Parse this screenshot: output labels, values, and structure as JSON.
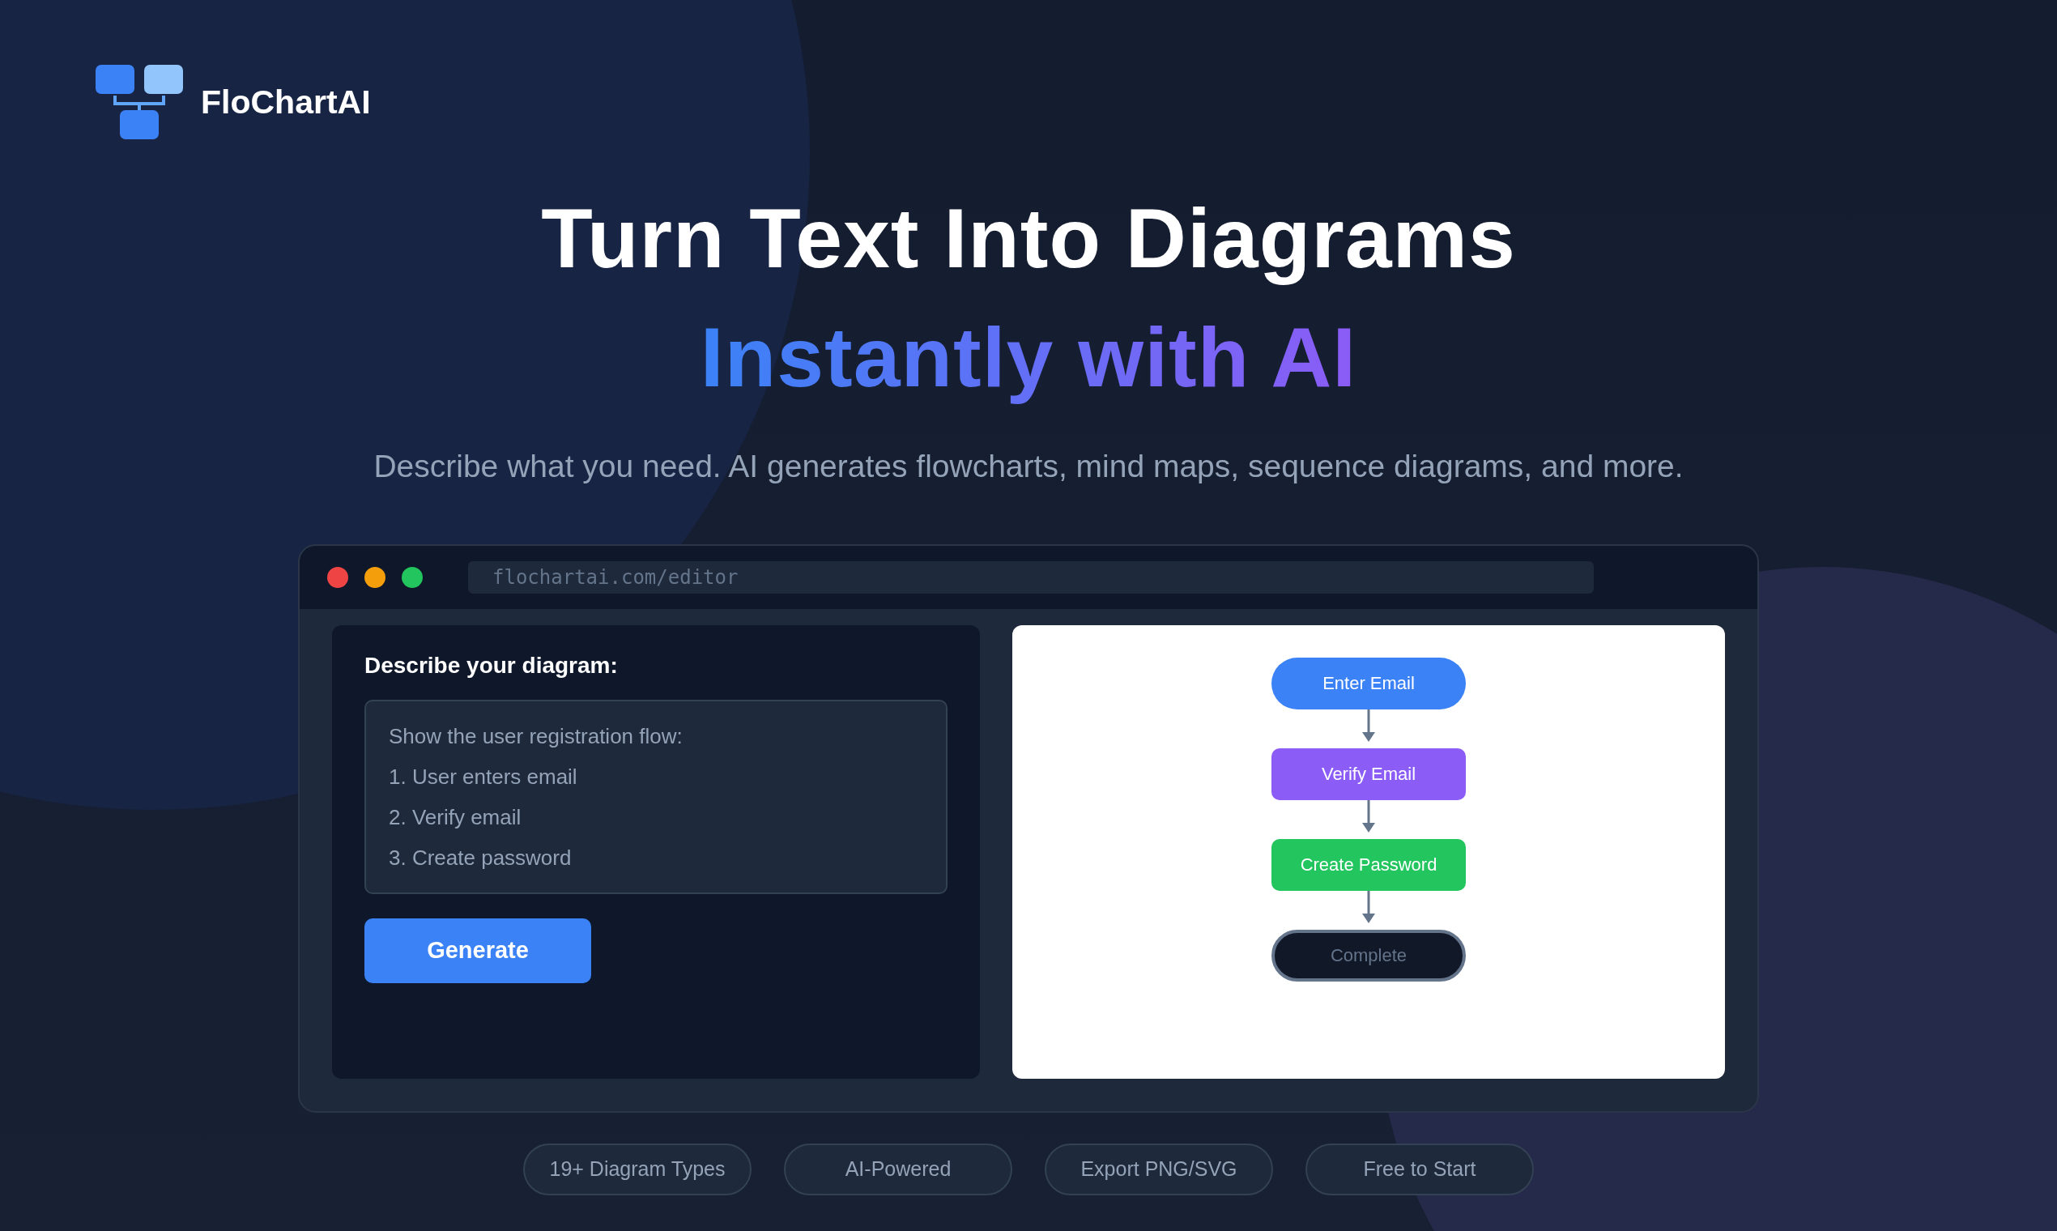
{
  "brand": {
    "name": "FloChartAI"
  },
  "hero": {
    "title": "Turn Text Into Diagrams",
    "highlight": "Instantly with AI",
    "subtitle": "Describe what you need. AI generates flowcharts, mind maps, sequence diagrams, and more."
  },
  "browser": {
    "url": "flochartai.com/editor"
  },
  "editor": {
    "label": "Describe your diagram:",
    "prompt_lines": [
      "Show the user registration flow:",
      "1. User enters email",
      "2. Verify email",
      "3. Create password"
    ],
    "button": "Generate"
  },
  "flowchart": {
    "nodes": [
      {
        "label": "Enter Email",
        "kind": "start",
        "color": "#3b82f6"
      },
      {
        "label": "Verify Email",
        "kind": "process",
        "color": "#8b5cf6"
      },
      {
        "label": "Create Password",
        "kind": "process",
        "color": "#22c55e"
      },
      {
        "label": "Complete",
        "kind": "end",
        "color": "#111827"
      }
    ]
  },
  "features": [
    "19+ Diagram Types",
    "AI-Powered",
    "Export PNG/SVG",
    "Free to Start"
  ]
}
